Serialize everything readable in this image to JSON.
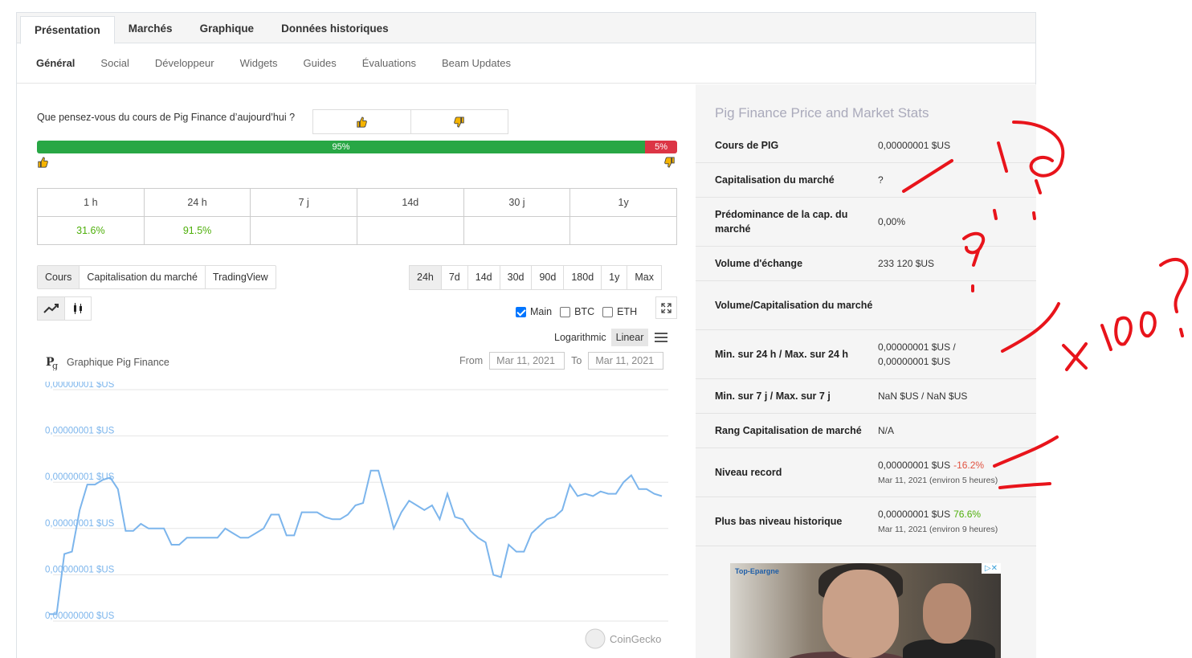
{
  "top_tabs": [
    "Présentation",
    "Marchés",
    "Graphique",
    "Données historiques"
  ],
  "sub_tabs": [
    "Général",
    "Social",
    "Développeur",
    "Widgets",
    "Guides",
    "Évaluations",
    "Beam Updates"
  ],
  "sentiment": {
    "question": "Que pensez-vous du cours de Pig Finance d’aujourd’hui ?",
    "up_pct": 95,
    "up_label": "95%",
    "down_label": "5%",
    "colors": {
      "up": "#28a745",
      "down": "#dc3545"
    }
  },
  "changes": {
    "headers": [
      "1 h",
      "24 h",
      "7 j",
      "14d",
      "30 j",
      "1y"
    ],
    "values": [
      "31.6%",
      "91.5%",
      "",
      "",
      "",
      ""
    ]
  },
  "chart_tabs": [
    "Cours",
    "Capitalisation du marché",
    "TradingView"
  ],
  "range_tabs": [
    "24h",
    "7d",
    "14d",
    "30d",
    "90d",
    "180d",
    "1y",
    "Max"
  ],
  "compare": [
    {
      "label": "Main",
      "checked": true
    },
    {
      "label": "BTC",
      "checked": false
    },
    {
      "label": "ETH",
      "checked": false
    }
  ],
  "scale": {
    "log": "Logarithmic",
    "linear": "Linear"
  },
  "chart_title": "Graphique Pig Finance",
  "date_range": {
    "from_label": "From",
    "from": "Mar 11, 2021",
    "to_label": "To",
    "to": "Mar 11, 2021"
  },
  "watermark": "CoinGecko",
  "chart_data": {
    "type": "line",
    "y_tick_labels": [
      "0,00000001 $US",
      "0,00000001 $US",
      "0,00000001 $US",
      "0,00000001 $US",
      "0,00000001 $US",
      "0,00000000 $US"
    ],
    "ylim": [
      0,
      5
    ],
    "grid": true,
    "series": [
      {
        "values": [
          0.15,
          0.15,
          1.45,
          1.5,
          2.4,
          2.95,
          2.95,
          3.05,
          3.1,
          2.85,
          1.95,
          1.95,
          2.1,
          2.0,
          2.0,
          2.0,
          1.65,
          1.65,
          1.8,
          1.8,
          1.8,
          1.8,
          1.8,
          2.0,
          1.9,
          1.8,
          1.8,
          1.9,
          2.0,
          2.3,
          2.3,
          1.85,
          1.85,
          2.35,
          2.35,
          2.35,
          2.25,
          2.2,
          2.2,
          2.3,
          2.5,
          2.55,
          3.25,
          3.25,
          2.65,
          2.0,
          2.35,
          2.6,
          2.5,
          2.4,
          2.5,
          2.2,
          2.75,
          2.25,
          2.2,
          1.95,
          1.8,
          1.7,
          1.0,
          0.95,
          1.65,
          1.5,
          1.5,
          1.9,
          2.05,
          2.2,
          2.25,
          2.4,
          2.95,
          2.7,
          2.75,
          2.7,
          2.8,
          2.75,
          2.75,
          3.0,
          3.15,
          2.85,
          2.85,
          2.75,
          2.7
        ]
      }
    ]
  },
  "stats": {
    "title": "Pig Finance Price and Market Stats",
    "rows": [
      {
        "label": "Cours de PIG",
        "value": "0,00000001 $US"
      },
      {
        "label": "Capitalisation du marché",
        "value": "?"
      },
      {
        "label": "Prédominance de la cap. du marché",
        "value": "0,00%"
      },
      {
        "label": "Volume d'échange",
        "value": "233 120 $US"
      },
      {
        "label": "Volume/Capitalisation du marché",
        "value": ""
      },
      {
        "label": "Min. sur 24 h / Max. sur 24 h",
        "value": "0,00000001 $US /",
        "value2": "0,00000001 $US"
      },
      {
        "label": "Min. sur 7 j / Max. sur 7 j",
        "value": "NaN $US / NaN $US"
      },
      {
        "label": "Rang Capitalisation de marché",
        "value": "N/A"
      },
      {
        "label": "Niveau record",
        "value": "0,00000001 $US",
        "change": "-16.2%",
        "sub": "Mar 11, 2021 (environ 5 heures)"
      },
      {
        "label": "Plus bas niveau historique",
        "value": "0,00000001 $US",
        "change": "76.6%",
        "sub": "Mar 11, 2021 (environ 9 heures)"
      }
    ]
  },
  "ad": {
    "label": "Top-Epargne",
    "close": "▷✕"
  },
  "annotation_color": "#e8141b"
}
